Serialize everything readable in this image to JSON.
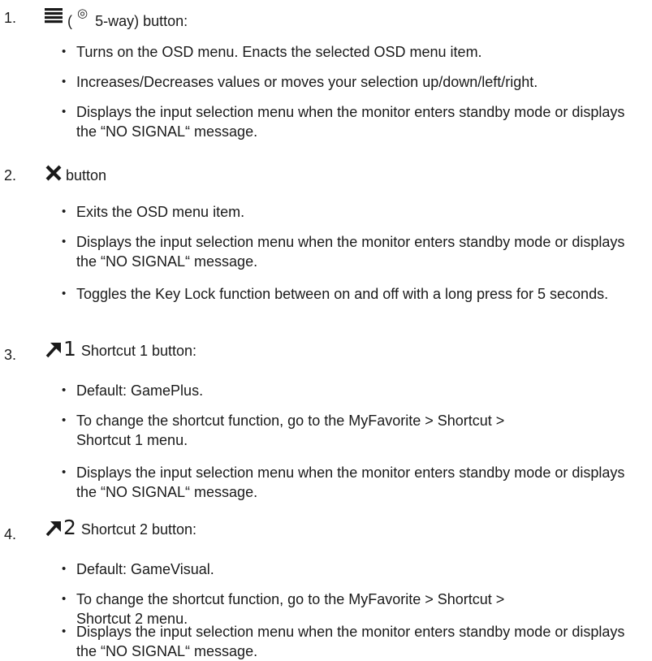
{
  "items": [
    {
      "number": "1.",
      "icon": "menu-lines-icon",
      "header_parts": {
        "open_paren": "(",
        "joystick_symbol": "◎",
        "rest": "5-way) button:"
      },
      "bullets": [
        "Turns on the OSD menu. Enacts the selected OSD menu item.",
        "Increases/Decreases values or moves your selection up/down/left/right.",
        "Displays the input selection menu when the monitor enters standby mode or displays the “NO SIGNAL“ message."
      ]
    },
    {
      "number": "2.",
      "icon": "close-x-icon",
      "header_text": "button",
      "bullets": [
        "Exits the OSD menu item.",
        "Displays the input selection menu when the monitor enters standby mode or displays the “NO SIGNAL“ message.",
        "Toggles the Key Lock function between on and off with a long press for 5 seconds."
      ]
    },
    {
      "number": "3.",
      "icon": "shortcut-arrow-icon",
      "icon_digit": "1",
      "header_text": "Shortcut 1 button:",
      "bullets": [
        "Default: GamePlus.",
        "To change the shortcut function, go to the MyFavorite > Shortcut > Shortcut 1 menu.",
        "Displays the input selection menu when the monitor enters standby mode or displays the “NO SIGNAL“ message."
      ]
    },
    {
      "number": "4.",
      "icon": "shortcut-arrow-icon",
      "icon_digit": "2",
      "header_text": "Shortcut 2 button:",
      "bullets": [
        "Default: GameVisual.",
        "To change the shortcut function, go to the MyFavorite > Shortcut > Shortcut 2 menu.",
        "Displays the input selection menu when the monitor enters standby mode or displays the “NO SIGNAL“ message."
      ]
    }
  ],
  "bullet_glyph": "•"
}
